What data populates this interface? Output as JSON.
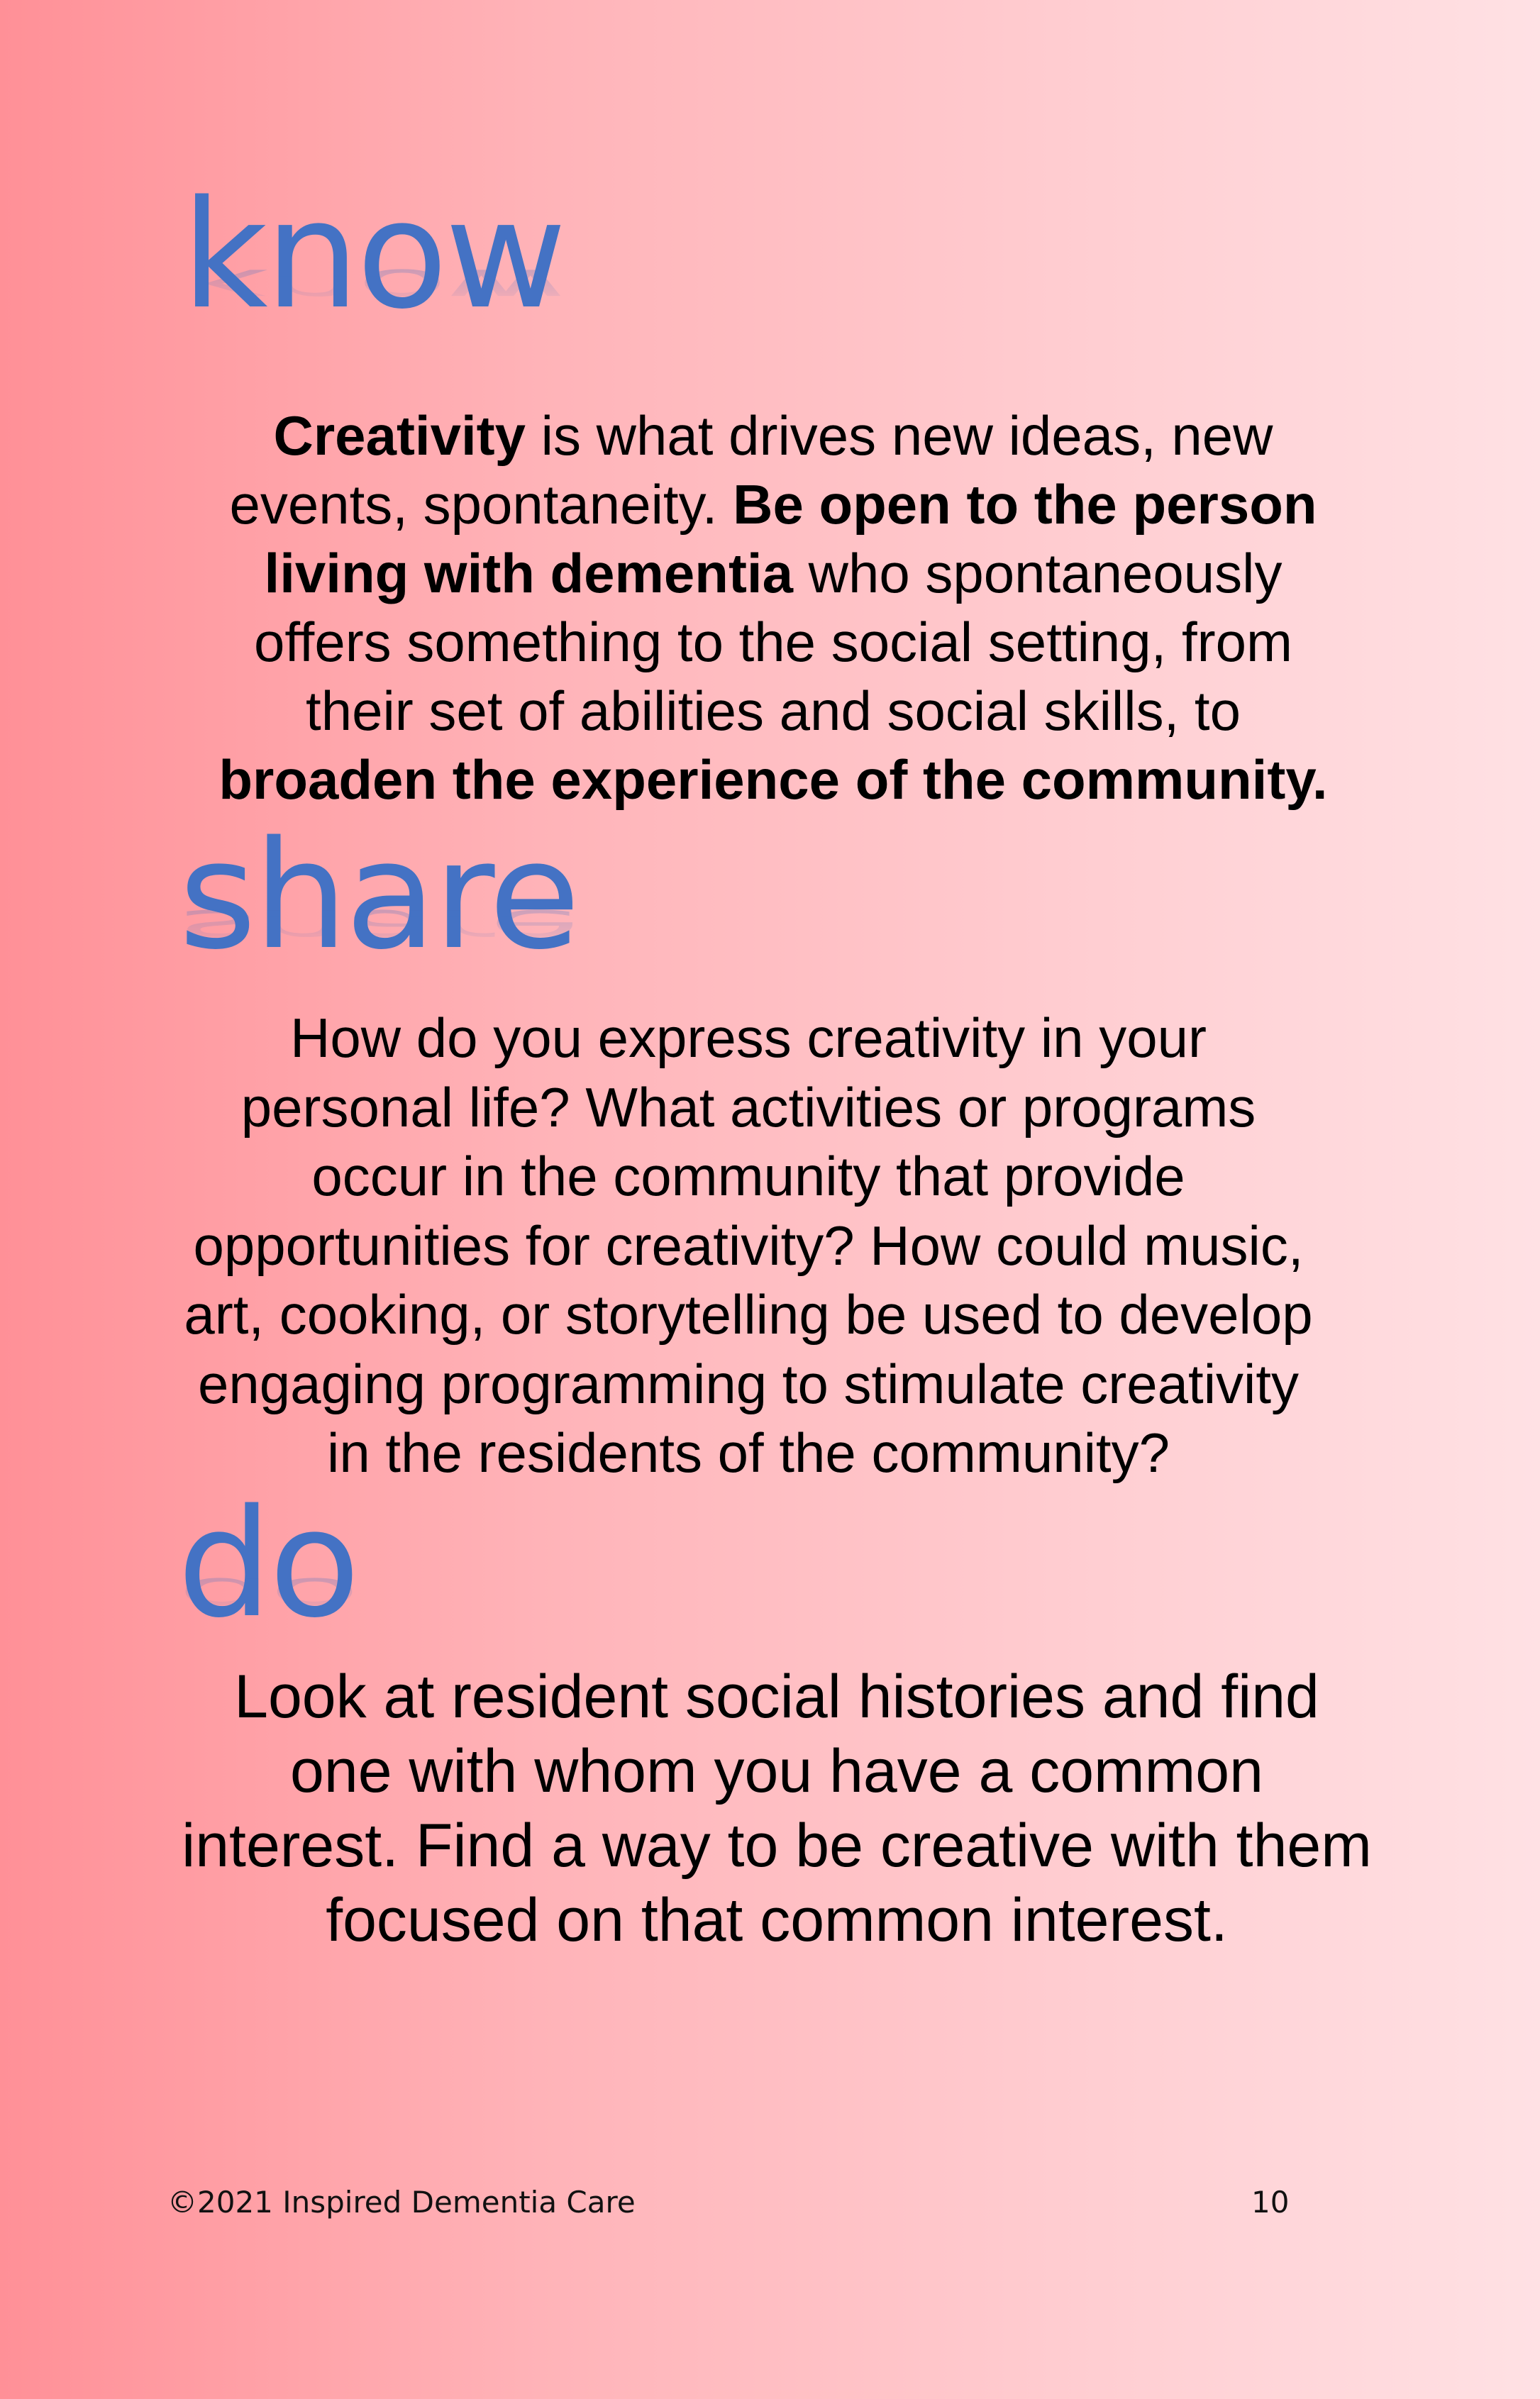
{
  "sections": {
    "know": {
      "heading": "know",
      "segments": [
        {
          "text": "Creativity",
          "bold": true
        },
        {
          "text": " is what drives new ideas, new",
          "bold": false
        },
        {
          "text": "\n",
          "bold": false
        },
        {
          "text": "events, spontaneity. ",
          "bold": false
        },
        {
          "text": "Be open to the person",
          "bold": true
        },
        {
          "text": "\n",
          "bold": false
        },
        {
          "text": "living with dementia",
          "bold": true
        },
        {
          "text": " who spontaneously",
          "bold": false
        },
        {
          "text": "\n",
          "bold": false
        },
        {
          "text": "offers something to the social setting, from",
          "bold": false
        },
        {
          "text": "\n",
          "bold": false
        },
        {
          "text": "their set of abilities and social skills, to",
          "bold": false
        },
        {
          "text": "\n",
          "bold": false
        },
        {
          "text": "broaden the experience of the community.",
          "bold": true
        }
      ]
    },
    "share": {
      "heading": "share",
      "lines": [
        "How do you express creativity in your",
        "personal life? What activities or programs",
        "occur in the community that provide",
        "opportunities for creativity? How could music,",
        "art, cooking, or storytelling be used to develop",
        "engaging programming to stimulate creativity",
        "in the residents of the community?"
      ]
    },
    "do": {
      "heading": "do",
      "lines": [
        "Look at resident social histories and find",
        "one with whom you have a common",
        "interest. Find a way to be creative with them",
        "focused on that common interest."
      ]
    }
  },
  "footer": {
    "copyright": "©2021 Inspired Dementia Care",
    "page_number": "10"
  },
  "colors": {
    "heading": "#4472c4",
    "background_left": "#ff9097",
    "background_right": "#ffe1e4"
  }
}
